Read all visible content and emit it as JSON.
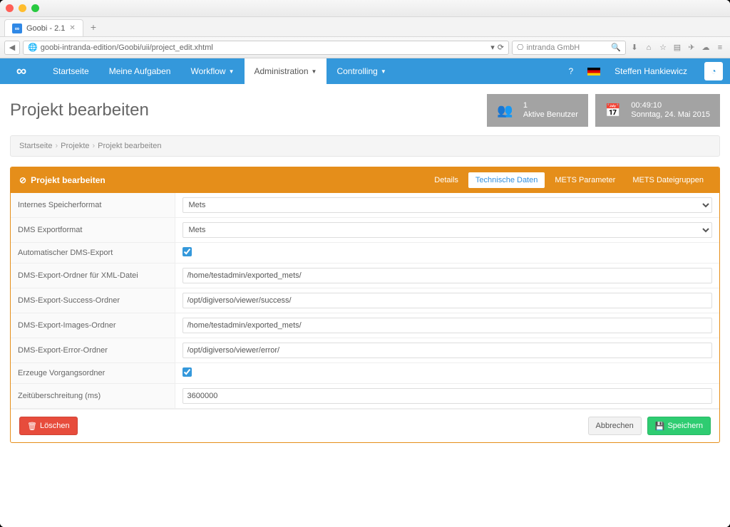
{
  "browser": {
    "tab_title": "Goobi - 2.1",
    "url": "goobi-intranda-edition/Goobi/uii/project_edit.xhtml",
    "search_placeholder": "intranda GmbH"
  },
  "nav": {
    "items": [
      "Startseite",
      "Meine Aufgaben",
      "Workflow",
      "Administration",
      "Controlling"
    ],
    "active_index": 3,
    "username": "Steffen Hankiewicz"
  },
  "page": {
    "title": "Projekt bearbeiten",
    "active_users": {
      "count": "1",
      "label": "Aktive Benutzer"
    },
    "clock": {
      "time": "00:49:10",
      "date": "Sonntag, 24. Mai 2015"
    }
  },
  "breadcrumb": [
    "Startseite",
    "Projekte",
    "Projekt bearbeiten"
  ],
  "panel": {
    "title": "Projekt bearbeiten",
    "tabs": [
      "Details",
      "Technische Daten",
      "METS Parameter",
      "METS Dateigruppen"
    ],
    "active_tab": 1
  },
  "form": {
    "rows": [
      {
        "label": "Internes Speicherformat",
        "type": "select",
        "value": "Mets"
      },
      {
        "label": "DMS Exportformat",
        "type": "select",
        "value": "Mets"
      },
      {
        "label": "Automatischer DMS-Export",
        "type": "checkbox",
        "checked": true
      },
      {
        "label": "DMS-Export-Ordner für XML-Datei",
        "type": "text",
        "value": "/home/testadmin/exported_mets/"
      },
      {
        "label": "DMS-Export-Success-Ordner",
        "type": "text",
        "value": "/opt/digiverso/viewer/success/"
      },
      {
        "label": "DMS-Export-Images-Ordner",
        "type": "text",
        "value": "/home/testadmin/exported_mets/"
      },
      {
        "label": "DMS-Export-Error-Ordner",
        "type": "text",
        "value": "/opt/digiverso/viewer/error/"
      },
      {
        "label": "Erzeuge Vorgangsordner",
        "type": "checkbox",
        "checked": true
      },
      {
        "label": "Zeitüberschreitung (ms)",
        "type": "text",
        "value": "3600000"
      }
    ]
  },
  "buttons": {
    "delete": "Löschen",
    "cancel": "Abbrechen",
    "save": "Speichern"
  }
}
